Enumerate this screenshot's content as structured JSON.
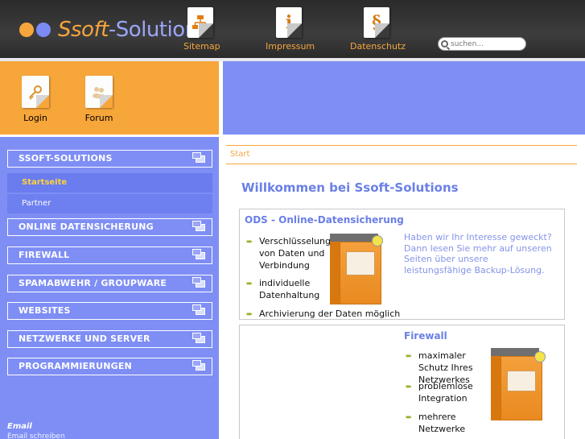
{
  "header": {
    "logo_main": "Ssoft",
    "logo_sub": "-Solutions",
    "nav": [
      {
        "label": "Sitemap",
        "icon": "sitemap-icon"
      },
      {
        "label": "Impressum",
        "icon": "info-icon"
      },
      {
        "label": "Datenschutz",
        "icon": "paragraph-icon"
      }
    ],
    "search_placeholder": "suchen..."
  },
  "userbox": {
    "login_label": "Login",
    "forum_label": "Forum"
  },
  "sidebar": {
    "sections": [
      "SSOFT-SOLUTIONS",
      "ONLINE DATENSICHERUNG",
      "FIREWALL",
      "SPAMABWEHR / GROUPWARE",
      "WEBSITES",
      "NETZWERKE UND SERVER",
      "PROGRAMMIERUNGEN"
    ],
    "subitems": [
      "Startseite",
      "Partner"
    ],
    "email_title": "Email",
    "email_sub": "Email schreiben"
  },
  "main": {
    "breadcrumb": "Start",
    "title": "Willkommen bei Ssoft-Solutions",
    "ods": {
      "title": "ODS - Online-Datensicherung",
      "bullets": [
        "Verschlüsselung von Daten und Verbindung",
        "individuelle Datenhaltung",
        "Archivierung der Daten möglich"
      ],
      "promo": "Haben wir Ihr Interesse geweckt? Dann lesen Sie mehr auf unseren Seiten über unsere leistungsfähige Backup-Lösung."
    },
    "firewall": {
      "title": "Firewall",
      "bullets": [
        "maximaler Schutz Ihres Netzwerkes",
        "problemlose Integration",
        "mehrere Netzwerke"
      ]
    }
  },
  "colors": {
    "orange": "#f7a63a",
    "blue": "#7e8ef5",
    "title_blue": "#6a7fe6"
  }
}
